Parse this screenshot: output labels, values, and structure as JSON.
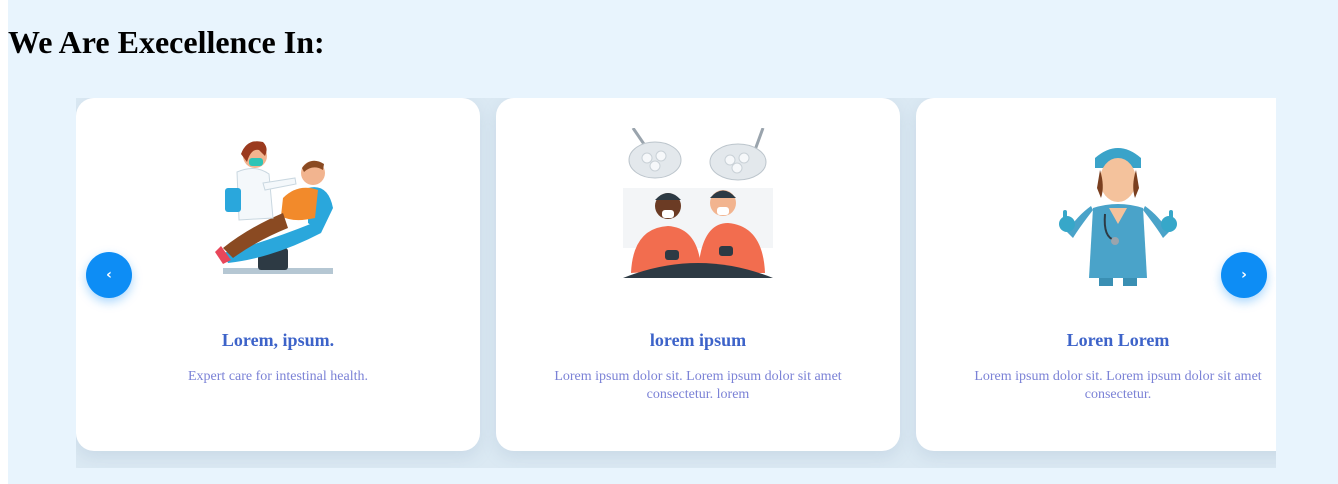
{
  "section": {
    "heading": "We Are Execellence In:"
  },
  "carousel": {
    "prev_icon": "‹",
    "next_icon": "›",
    "cards": [
      {
        "icon": "dentist-illustration",
        "title": "Lorem, ipsum.",
        "description": "Expert care for intestinal health."
      },
      {
        "icon": "surgeons-illustration",
        "title": "lorem ipsum",
        "description": "Lorem ipsum dolor sit. Lorem ipsum dolor sit amet consectetur. lorem"
      },
      {
        "icon": "nurse-illustration",
        "title": "Loren Lorem",
        "description": "Lorem ipsum dolor sit. Lorem ipsum dolor sit amet consectetur."
      }
    ]
  },
  "colors": {
    "page_background": "#e8f4fd",
    "card_title": "#3d63c9",
    "card_description": "#7b82d6",
    "nav_button": "#0d8df5"
  }
}
